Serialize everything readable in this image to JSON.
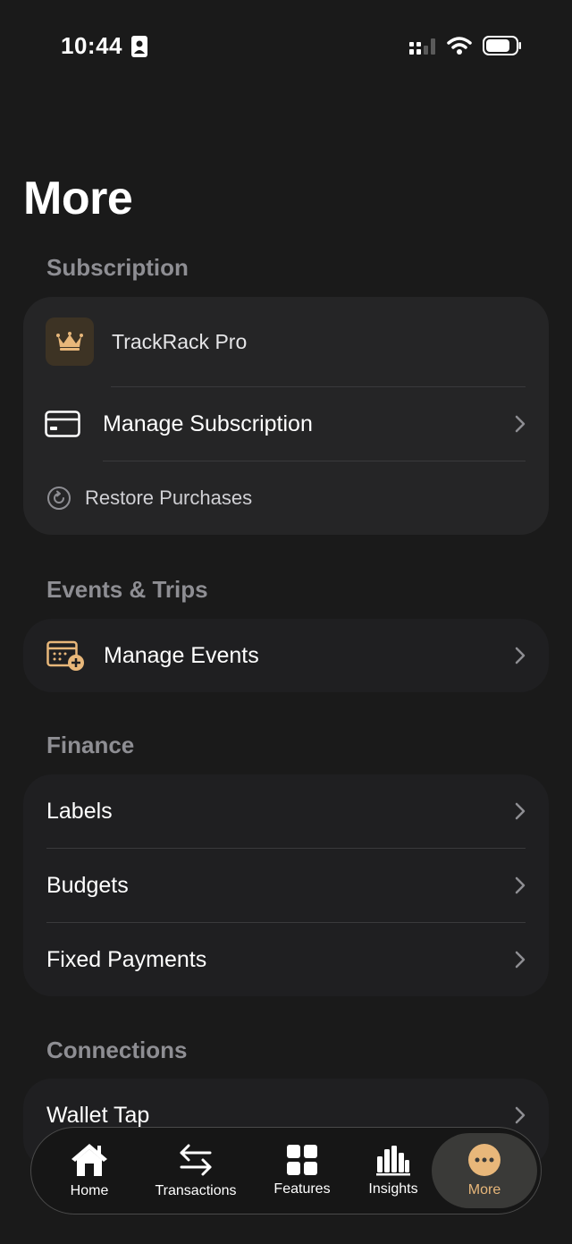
{
  "status": {
    "time": "10:44"
  },
  "page": {
    "title": "More"
  },
  "sections": {
    "subscription": {
      "header": "Subscription",
      "pro_label": "TrackRack Pro",
      "manage_label": "Manage Subscription",
      "restore_label": "Restore Purchases"
    },
    "events": {
      "header": "Events & Trips",
      "manage_events_label": "Manage Events"
    },
    "finance": {
      "header": "Finance",
      "items": [
        "Labels",
        "Budgets",
        "Fixed Payments"
      ]
    },
    "connections": {
      "header": "Connections",
      "items": [
        "Wallet Tap"
      ]
    }
  },
  "tabs": [
    {
      "label": "Home",
      "icon": "house-icon"
    },
    {
      "label": "Transactions",
      "icon": "arrows-exchange-icon"
    },
    {
      "label": "Features",
      "icon": "grid-icon"
    },
    {
      "label": "Insights",
      "icon": "bar-chart-icon"
    },
    {
      "label": "More",
      "icon": "ellipsis-icon",
      "active": true
    }
  ],
  "colors": {
    "background": "#1a1a1a",
    "card": "#252526",
    "accent": "#e8b77a",
    "section_header": "#8e8e93"
  }
}
